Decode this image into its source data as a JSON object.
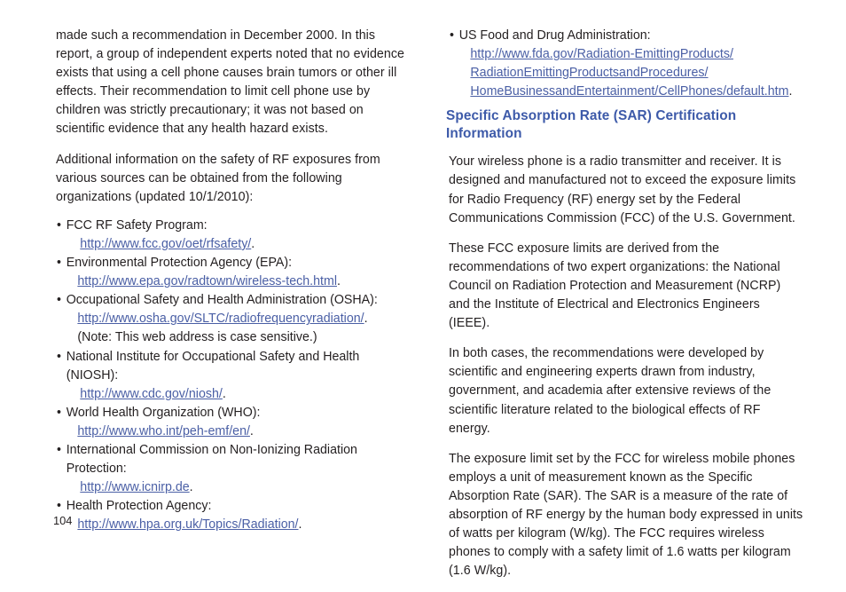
{
  "document": {
    "page_number": "104",
    "link_color": "#4a5fa5",
    "heading_color": "#3d5aa9",
    "text_color": "#231f20",
    "background_color": "#ffffff"
  },
  "left_column": {
    "paragraphs": [
      "made such a recommendation in December 2000. In this report, a group of independent experts noted that no evidence exists that using a cell phone causes brain tumors or other ill effects. Their recommendation to limit cell phone use by children was strictly precautionary; it was not based on scientific evidence that any health hazard exists.",
      "Additional information on the safety of RF exposures from various sources can be obtained from the following organizations (updated 10/1/2010):"
    ],
    "bullet_marker": "•",
    "bullets": [
      {
        "label": "FCC RF Safety Program:",
        "url": "http://www.fcc.gov/oet/rfsafety/",
        "trailing": ".",
        "note": ""
      },
      {
        "label": "Environmental Protection Agency (EPA):",
        "url": "http://www.epa.gov/radtown/wireless-tech.html",
        "trailing": ".",
        "note": ""
      },
      {
        "label": "Occupational Safety and Health Administration (OSHA):",
        "url": "http://www.osha.gov/SLTC/radiofrequencyradiation/",
        "trailing": ".",
        "note": "(Note: This web address is case sensitive.)"
      },
      {
        "label": "National Institute for Occupational Safety and Health (NIOSH):",
        "url": "http://www.cdc.gov/niosh/",
        "trailing": ".",
        "note": ""
      },
      {
        "label": "World Health Organization (WHO):",
        "url": "http://www.who.int/peh-emf/en/",
        "trailing": ".",
        "note": ""
      },
      {
        "label": "International Commission on Non-Ionizing Radiation Protection:",
        "url": "http://www.icnirp.de",
        "trailing": ".",
        "note": ""
      },
      {
        "label": "Health Protection Agency:",
        "url": "http://www.hpa.org.uk/Topics/Radiation/",
        "trailing": ".",
        "note": ""
      }
    ]
  },
  "right_column": {
    "bullet_marker": "•",
    "fda_bullet": {
      "label": "US Food and Drug Administration:",
      "url_lines": [
        "http://www.fda.gov/Radiation-EmittingProducts/",
        "RadiationEmittingProductsandProcedures/",
        "HomeBusinessandEntertainment/CellPhones/default.htm"
      ],
      "trailing": "."
    },
    "heading": "Specific Absorption Rate (SAR) Certification Information",
    "paragraphs": [
      "Your wireless phone is a radio transmitter and receiver. It is designed and manufactured not to exceed the exposure limits for Radio Frequency (RF) energy set by the Federal Communications Commission (FCC) of the U.S. Government.",
      "These FCC exposure limits are derived from the recommendations of two expert organizations: the National Council on Radiation Protection and Measurement (NCRP) and the Institute of Electrical and Electronics Engineers (IEEE).",
      "In both cases, the recommendations were developed by scientific and engineering experts drawn from industry, government, and academia after extensive reviews of the scientific literature related to the biological effects of RF energy.",
      "The exposure limit set by the FCC for wireless mobile phones employs a unit of measurement known as the Specific Absorption Rate (SAR). The SAR is a measure of the rate of absorption of RF energy by the human body expressed in units of watts per kilogram (W/kg). The FCC requires wireless phones to comply with a safety limit of 1.6 watts per kilogram (1.6 W/kg)."
    ]
  }
}
